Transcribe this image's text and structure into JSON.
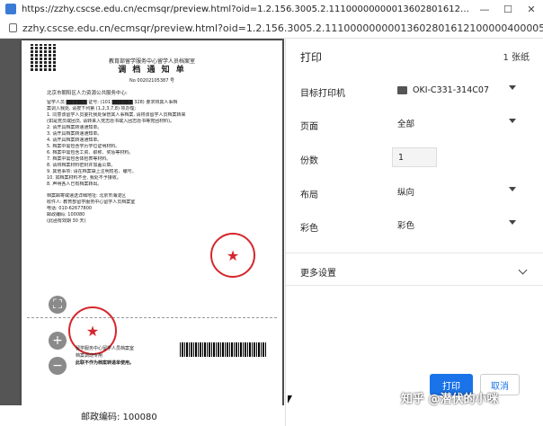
{
  "titlebar": {
    "title": "https://zzhy.cscse.edu.cn/ecmsqr/preview.html?oid=1.2.156.3005.2.1110000000001360280161210000040000536Y00"
  },
  "addressbar": {
    "url": "zzhy.cscse.edu.cn/ecmsqr/preview.html?oid=1.2.156.3005.2.1110000000001360280161210000040000536Y00001.00..."
  },
  "document": {
    "header1": "教育部留学服务中心留学人员档案室",
    "header2": "调 档 通 知 单",
    "number": "No 00202105387 号",
    "addressee": "北京市朝阳区人力资源公共服务中心:",
    "body_lines": [
      "留学人员 ██████ 证号: (101 ██████ 328) 要求将其人事档",
      "案调入我处, 请按下列第 (1,2,3,7,8) 项办理:",
      "1. 同意该留学人员委托我处保管其人事档案, 请将该留学人员档案转来",
      "(如是党员或团员, 请转来入党志愿书或入团志愿书等党团材料)。",
      "2. 请开具档案转递通知单。",
      "3. 请开具档案转递通知单。",
      "4. 请开具档案转递通知单。",
      "5. 档案中需包含学历学位证明材料。",
      "6. 档案中需包含工资、职称、奖惩等材料。",
      "7. 档案中需包含体检表等材料。",
      "8. 请将档案材料密封并加盖公章。",
      "9. 其他事项: 请在档案袋上注明姓名、编号。",
      "10. 如档案材料不全, 我处不予接收。",
      "8. 声明各人已有档案转出。"
    ],
    "contact_lines": [
      "档案邮寄或递送详细地址: 北京市海淀区",
      "收件人: 教育部留学服务中心留学人员档案室",
      "电话: 010-62677800",
      "邮政编码: 100080",
      "(此函有效期 30 天)"
    ],
    "footer_lines": [
      "留学服务中心留学人员档案室",
      "档案调动专用",
      "此联不作为档案转递单使用。"
    ],
    "stamp_glyph": "★"
  },
  "bottom_strip": {
    "text": "邮政编码: 100080"
  },
  "zoom": {
    "fit_label": "⛶",
    "zoom_in_label": "+",
    "zoom_out_label": "−"
  },
  "panel": {
    "title": "打印",
    "page_count": "1 张纸",
    "destination_label": "目标打印机",
    "destination_value": "OKI-C331-314C07",
    "pages_label": "页面",
    "pages_value": "全部",
    "copies_label": "份数",
    "copies_value": "1",
    "layout_label": "布局",
    "layout_value": "纵向",
    "color_label": "彩色",
    "color_value": "彩色",
    "more_settings_label": "更多设置",
    "print_button": "打印",
    "cancel_button": "取消"
  },
  "watermark": {
    "text": "知乎 @潜伏的小咪"
  },
  "colors": {
    "accent": "#1a73e8",
    "stamp": "#d6262b"
  }
}
